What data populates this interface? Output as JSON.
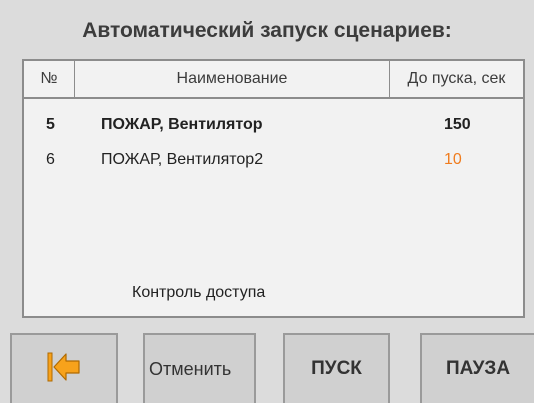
{
  "title": "Автоматический запуск сценариев:",
  "table": {
    "headers": {
      "num": "№",
      "name": "Наименование",
      "time": "До пуска, сек"
    },
    "rows": [
      {
        "num": "5",
        "name": "ПОЖАР, Вентилятор",
        "time": "150",
        "time_color": "#222222"
      },
      {
        "num": "6",
        "name": "ПОЖАР, Вентилятор2",
        "time": "10",
        "time_color": "#f07c1e"
      }
    ],
    "footer_text": "Контроль доступа"
  },
  "buttons": {
    "back_icon": "arrow-back-icon",
    "cancel": "Отменить",
    "start": "ПУСК",
    "pause": "ПАУЗА"
  },
  "colors": {
    "accent": "#f7a21b"
  }
}
